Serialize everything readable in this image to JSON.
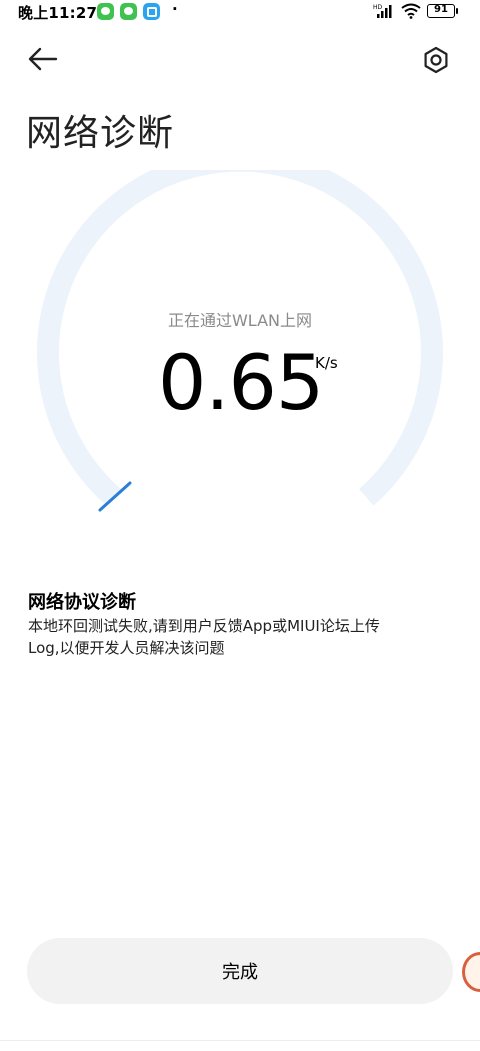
{
  "status_bar": {
    "time": "晚上11:27",
    "dot": "·",
    "signal_label": "HD",
    "battery": "91"
  },
  "header": {
    "title": "网络诊断"
  },
  "gauge": {
    "connection_label": "正在通过WLAN上网",
    "speed_value": "0.65",
    "speed_unit": "K/s",
    "track_color": "#edf3fb",
    "progress_color": "#2a7fd6"
  },
  "info": {
    "title": "网络协议诊断",
    "line1": "本地环回测试失败,请到用户反馈App或MIUI论坛上传",
    "line2": "Log,以便开发人员解决该问题"
  },
  "footer": {
    "done_label": "完成"
  }
}
